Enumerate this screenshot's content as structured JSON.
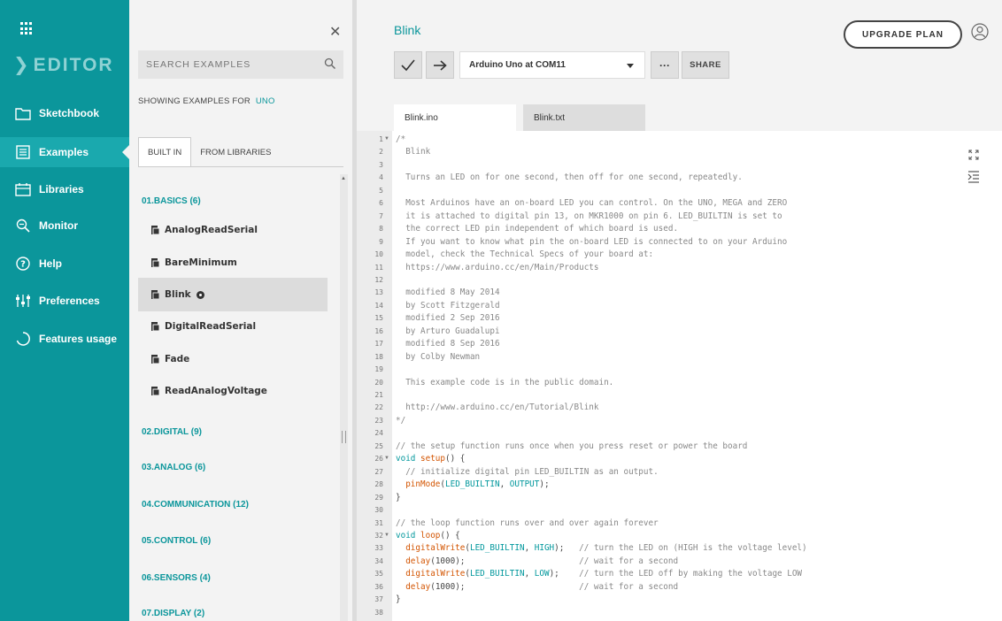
{
  "sidebar": {
    "brand": "EDITOR",
    "items": [
      {
        "label": "Sketchbook",
        "icon": "folder-icon"
      },
      {
        "label": "Examples",
        "icon": "examples-icon"
      },
      {
        "label": "Libraries",
        "icon": "libraries-icon"
      },
      {
        "label": "Monitor",
        "icon": "monitor-icon"
      },
      {
        "label": "Help",
        "icon": "help-icon"
      },
      {
        "label": "Preferences",
        "icon": "preferences-icon"
      },
      {
        "label": "Features usage",
        "icon": "features-icon"
      }
    ],
    "active_index": 1
  },
  "examples_panel": {
    "search_placeholder": "SEARCH EXAMPLES",
    "showing_prefix": "SHOWING EXAMPLES FOR",
    "board": "UNO",
    "tabs": [
      "BUILT IN",
      "FROM LIBRARIES"
    ],
    "active_tab": 0,
    "categories": [
      "01.BASICS (6)",
      "02.DIGITAL (9)",
      "03.ANALOG (6)",
      "04.COMMUNICATION (12)",
      "05.CONTROL (6)",
      "06.SENSORS (4)",
      "07.DISPLAY (2)"
    ],
    "examples": [
      "AnalogReadSerial",
      "BareMinimum",
      "Blink",
      "DigitalReadSerial",
      "Fade",
      "ReadAnalogVoltage"
    ],
    "selected_example": "Blink"
  },
  "editor": {
    "sketch_title": "Blink",
    "upgrade_label": "UPGRADE PLAN",
    "board_select": "Arduino Uno at COM11",
    "more_label": "···",
    "share_label": "SHARE",
    "file_tabs": [
      "Blink.ino",
      "Blink.txt"
    ],
    "active_file_tab": 0
  },
  "code": {
    "line_numbers": [
      "1",
      "2",
      "3",
      "4",
      "5",
      "6",
      "7",
      "8",
      "9",
      "10",
      "11",
      "12",
      "13",
      "14",
      "15",
      "16",
      "17",
      "18",
      "19",
      "20",
      "21",
      "22",
      "23",
      "24",
      "25",
      "26",
      "27",
      "28",
      "29",
      "30",
      "31",
      "32",
      "33",
      "34",
      "35",
      "36",
      "37",
      "38"
    ],
    "fold_lines": [
      1,
      26,
      32
    ],
    "lines": [
      "/*",
      "  Blink",
      "",
      "  Turns an LED on for one second, then off for one second, repeatedly.",
      "",
      "  Most Arduinos have an on-board LED you can control. On the UNO, MEGA and ZERO",
      "  it is attached to digital pin 13, on MKR1000 on pin 6. LED_BUILTIN is set to",
      "  the correct LED pin independent of which board is used.",
      "  If you want to know what pin the on-board LED is connected to on your Arduino",
      "  model, check the Technical Specs of your board at:",
      "  https://www.arduino.cc/en/Main/Products",
      "",
      "  modified 8 May 2014",
      "  by Scott Fitzgerald",
      "  modified 2 Sep 2016",
      "  by Arturo Guadalupi",
      "  modified 8 Sep 2016",
      "  by Colby Newman",
      "",
      "  This example code is in the public domain.",
      "",
      "  http://www.arduino.cc/en/Tutorial/Blink",
      "*/",
      "",
      "// the setup function runs once when you press reset or power the board",
      "void setup() {",
      "  // initialize digital pin LED_BUILTIN as an output.",
      "  pinMode(LED_BUILTIN, OUTPUT);",
      "}",
      "",
      "// the loop function runs over and over again forever",
      "void loop() {",
      "  digitalWrite(LED_BUILTIN, HIGH);   // turn the LED on (HIGH is the voltage level)",
      "  delay(1000);                       // wait for a second",
      "  digitalWrite(LED_BUILTIN, LOW);    // turn the LED off by making the voltage LOW",
      "  delay(1000);                       // wait for a second",
      "}",
      ""
    ]
  },
  "colors": {
    "teal": "#0b969b",
    "keyword": "#00979c",
    "function": "#d35400"
  }
}
